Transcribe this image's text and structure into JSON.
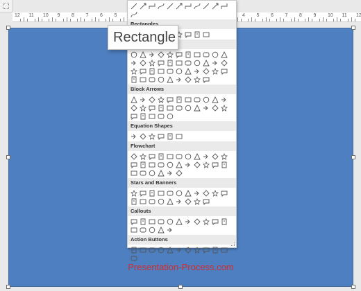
{
  "ruler": {
    "labels": [
      "12",
      "11",
      "10",
      "9",
      "8",
      "7",
      "6",
      "5",
      "4",
      "3",
      "2",
      "1",
      "0",
      "1",
      "2",
      "3",
      "4",
      "5",
      "6",
      "7",
      "8",
      "9",
      "10",
      "11",
      "12"
    ]
  },
  "tooltip": {
    "text": "Rectangle"
  },
  "slide": {
    "color": "#4e7fc0",
    "watermark": "Presentation-Process.com",
    "watermark_color": "#d42b2b"
  },
  "gallery": {
    "sections": [
      {
        "title": "",
        "icons": [
          "line",
          "line-arrow",
          "line-double-arrow",
          "elbow-connector",
          "elbow-arrow-connector",
          "elbow-double-arrow",
          "curved-connector",
          "curved-arrow-connector",
          "curved-double-arrow",
          "curve",
          "freeform",
          "scribble"
        ]
      },
      {
        "title": "Rectangles",
        "icons": [
          "rectangle",
          "rounded-rectangle",
          "snip-single-corner",
          "snip-same-side",
          "snip-diagonal",
          "snip-round",
          "round-single-corner",
          "round-same-side",
          "round-diagonal"
        ]
      },
      {
        "title": "Basic Shapes",
        "icons": [
          "text-box",
          "oval",
          "triangle",
          "right-triangle",
          "parallelogram",
          "trapezoid",
          "diamond",
          "pentagon",
          "hexagon",
          "heptagon",
          "octagon",
          "decagon",
          "dodecagon",
          "pie",
          "chord",
          "teardrop",
          "frame",
          "half-frame",
          "l-shape",
          "diagonal-stripe",
          "plus",
          "plaque",
          "can",
          "cube",
          "bevel",
          "donut",
          "no-symbol",
          "block-arc",
          "folded-corner",
          "smiley",
          "heart",
          "lightning",
          "sun",
          "moon",
          "cloud",
          "arc",
          "double-bracket",
          "double-brace",
          "left-bracket",
          "right-bracket",
          "left-brace",
          "right-brace"
        ]
      },
      {
        "title": "Block Arrows",
        "icons": [
          "right-arrow",
          "left-arrow",
          "up-arrow",
          "down-arrow",
          "left-right-arrow",
          "up-down-arrow",
          "quad-arrow",
          "left-right-up-arrow",
          "bent-arrow",
          "u-turn-arrow",
          "left-up-arrow",
          "bent-up-arrow",
          "curved-right-arrow",
          "curved-left-arrow",
          "curved-up-arrow",
          "curved-down-arrow",
          "striped-right-arrow",
          "notched-right-arrow",
          "pentagon-arrow",
          "chevron",
          "right-arrow-callout",
          "down-arrow-callout",
          "left-arrow-callout",
          "up-arrow-callout",
          "left-right-arrow-callout",
          "quad-arrow-callout",
          "circular-arrow"
        ]
      },
      {
        "title": "Equation Shapes",
        "icons": [
          "plus-sign",
          "minus-sign",
          "multiply-sign",
          "division-sign",
          "equal-sign",
          "not-equal-sign"
        ]
      },
      {
        "title": "Flowchart",
        "icons": [
          "process",
          "alternate-process",
          "decision",
          "data",
          "predefined-process",
          "internal-storage",
          "document",
          "multidocument",
          "terminator",
          "preparation",
          "manual-input",
          "manual-operation",
          "connector",
          "off-page-connector",
          "card",
          "punched-tape",
          "summing-junction",
          "or",
          "collate",
          "sort",
          "extract",
          "merge",
          "stored-data",
          "delay",
          "sequential-access",
          "magnetic-disk",
          "direct-access",
          "display"
        ]
      },
      {
        "title": "Stars and Banners",
        "icons": [
          "explosion-1",
          "explosion-2",
          "star-4",
          "star-5",
          "star-6",
          "star-7",
          "star-8",
          "star-10",
          "star-12",
          "star-16",
          "star-24",
          "star-32",
          "up-ribbon",
          "down-ribbon",
          "curved-up-ribbon",
          "curved-down-ribbon",
          "vertical-scroll",
          "horizontal-scroll",
          "wave",
          "double-wave"
        ]
      },
      {
        "title": "Callouts",
        "icons": [
          "rect-callout",
          "rounded-rect-callout",
          "oval-callout",
          "cloud-callout",
          "line-callout-1",
          "line-callout-2",
          "line-callout-3",
          "line-callout-1-accent",
          "line-callout-2-accent",
          "line-callout-3-accent",
          "line-callout-1-nb",
          "line-callout-2-nb",
          "line-callout-3-nb",
          "line-callout-1-border",
          "line-callout-2-border",
          "line-callout-3-border"
        ]
      },
      {
        "title": "Action Buttons",
        "icons": [
          "back-button",
          "forward-button",
          "beginning-button",
          "end-button",
          "home-button",
          "information-button",
          "return-button",
          "movie-button",
          "document-button",
          "sound-button",
          "help-button",
          "custom-button"
        ]
      }
    ]
  }
}
